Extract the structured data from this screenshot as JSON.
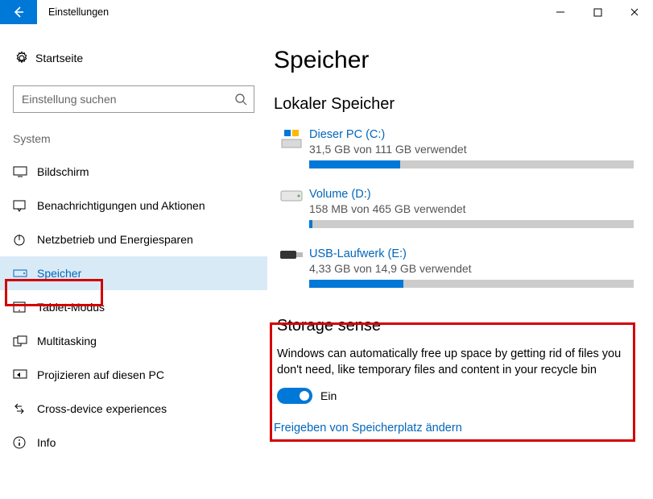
{
  "window": {
    "title": "Einstellungen"
  },
  "sidebar": {
    "home": "Startseite",
    "search_placeholder": "Einstellung suchen",
    "section": "System",
    "items": [
      {
        "label": "Bildschirm"
      },
      {
        "label": "Benachrichtigungen und Aktionen"
      },
      {
        "label": "Netzbetrieb und Energiesparen"
      },
      {
        "label": "Speicher"
      },
      {
        "label": "Tablet-Modus"
      },
      {
        "label": "Multitasking"
      },
      {
        "label": "Projizieren auf diesen PC"
      },
      {
        "label": "Cross-device experiences"
      },
      {
        "label": "Info"
      }
    ]
  },
  "main": {
    "heading": "Speicher",
    "local_heading": "Lokaler Speicher",
    "drives": [
      {
        "name": "Dieser PC (C:)",
        "usage": "31,5 GB von 111 GB verwendet",
        "pct": 28
      },
      {
        "name": "Volume (D:)",
        "usage": "158 MB von 465 GB verwendet",
        "pct": 1
      },
      {
        "name": "USB-Laufwerk (E:)",
        "usage": "4,33 GB von 14,9 GB verwendet",
        "pct": 29
      }
    ],
    "storage_sense": {
      "title": "Storage sense",
      "desc": "Windows can automatically free up space by getting rid of files you don't need, like temporary files and content in your recycle bin",
      "toggle_label": "Ein"
    },
    "change_link": "Freigeben von Speicherplatz ändern"
  }
}
